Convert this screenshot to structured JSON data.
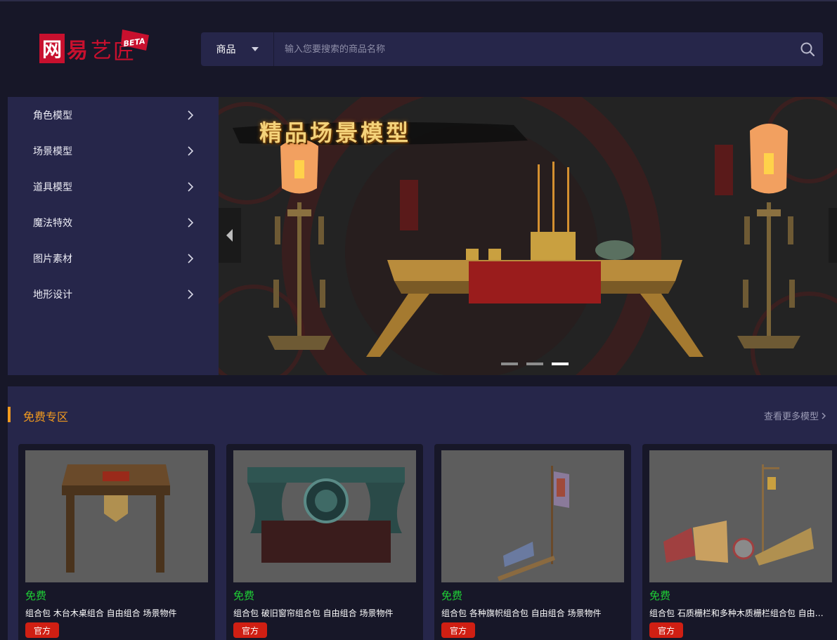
{
  "header": {
    "logo_text": "网易艺匠",
    "logo_badge": "BETA",
    "search": {
      "category": "商品",
      "placeholder": "输入您要搜索的商品名称"
    }
  },
  "sidebar": {
    "items": [
      {
        "label": "角色模型"
      },
      {
        "label": "场景模型"
      },
      {
        "label": "道具模型"
      },
      {
        "label": "魔法特效"
      },
      {
        "label": "图片素材"
      },
      {
        "label": "地形设计"
      }
    ]
  },
  "banner": {
    "title": "精品场景模型",
    "slides": 3,
    "active_slide": 3
  },
  "free_zone": {
    "title": "免费专区",
    "more_link": "查看更多模型",
    "cards": [
      {
        "price": "免费",
        "name": "组合包 木台木桌组合 自由组合 场景物件",
        "badge": "官方"
      },
      {
        "price": "免费",
        "name": "组合包 破旧窗帘组合包 自由组合 场景物件",
        "badge": "官方"
      },
      {
        "price": "免费",
        "name": "组合包 各种旗帜组合包 自由组合 场景物件",
        "badge": "官方"
      },
      {
        "price": "免费",
        "name": "组合包 石质栅栏和多种木质栅栏组合包 自由组合 场景物件",
        "badge": "官方"
      }
    ]
  },
  "colors": {
    "background": "#171728",
    "panel": "#26264a",
    "accent_orange": "#f29b1f",
    "free_green": "#1fcf36",
    "badge_red": "#d01f13",
    "logo_red": "#c8102e"
  },
  "icons": {
    "search": "search-icon",
    "caret": "caret-down-icon",
    "chevron": "chevron-right-icon",
    "arrow_left": "arrow-left-icon"
  }
}
